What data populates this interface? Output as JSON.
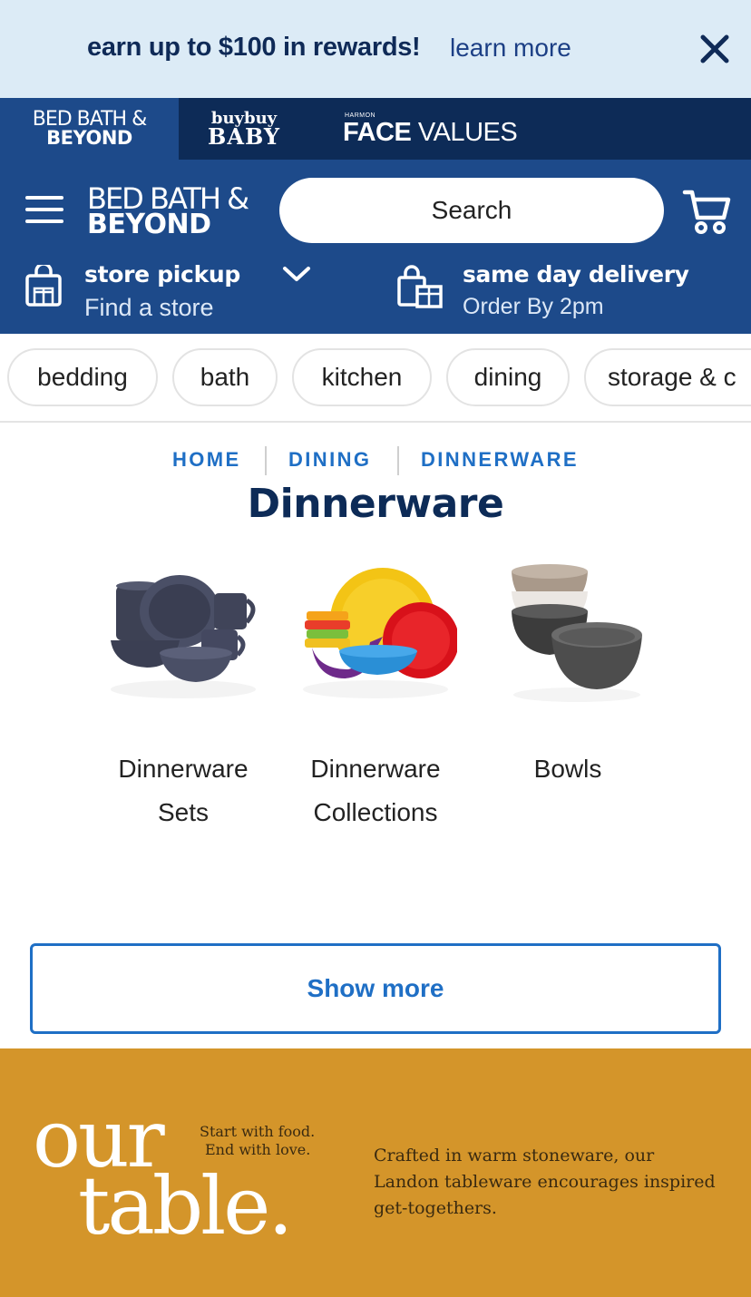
{
  "promo": {
    "text": "earn up to $100 in rewards!",
    "link": "learn more"
  },
  "brands": {
    "bbb_line1": "BED BATH &",
    "bbb_line2": "BEYOND",
    "baby_line1": "buybuy",
    "baby_line2": "BABY",
    "face_line0": "HARMON",
    "face_bold": "FACE",
    "face_rest": " VALUES"
  },
  "header": {
    "logo_line1": "BED BATH &",
    "logo_line2": "BEYOND",
    "search_placeholder": "Search",
    "pickup_title": "store pickup",
    "pickup_sub": "Find a store",
    "delivery_title": "same day delivery",
    "delivery_sub": "Order By 2pm"
  },
  "categories": [
    "bedding",
    "bath",
    "kitchen",
    "dining",
    "storage & c"
  ],
  "breadcrumb": [
    "HOME",
    "DINING",
    "DINNERWARE"
  ],
  "page_title": "Dinnerware",
  "tiles": [
    {
      "line1": "Dinnerware",
      "line2": "Sets"
    },
    {
      "line1": "Dinnerware",
      "line2": "Collections"
    },
    {
      "line1": "Bowls",
      "line2": ""
    }
  ],
  "show_more": "Show more",
  "banner": {
    "our": "our",
    "table": "table.",
    "tag1": "Start with food.",
    "tag2": "End with love.",
    "copy": "Crafted in warm stoneware, our Landon tableware encourages inspired get-togethers."
  },
  "colors": {
    "promo_bg": "#dcebf6",
    "brand_strip": "#0d2b57",
    "header_blue": "#1d4a8a",
    "link_blue": "#1f6fc5",
    "title_navy": "#0d2b57",
    "banner_gold": "#d4952a"
  }
}
